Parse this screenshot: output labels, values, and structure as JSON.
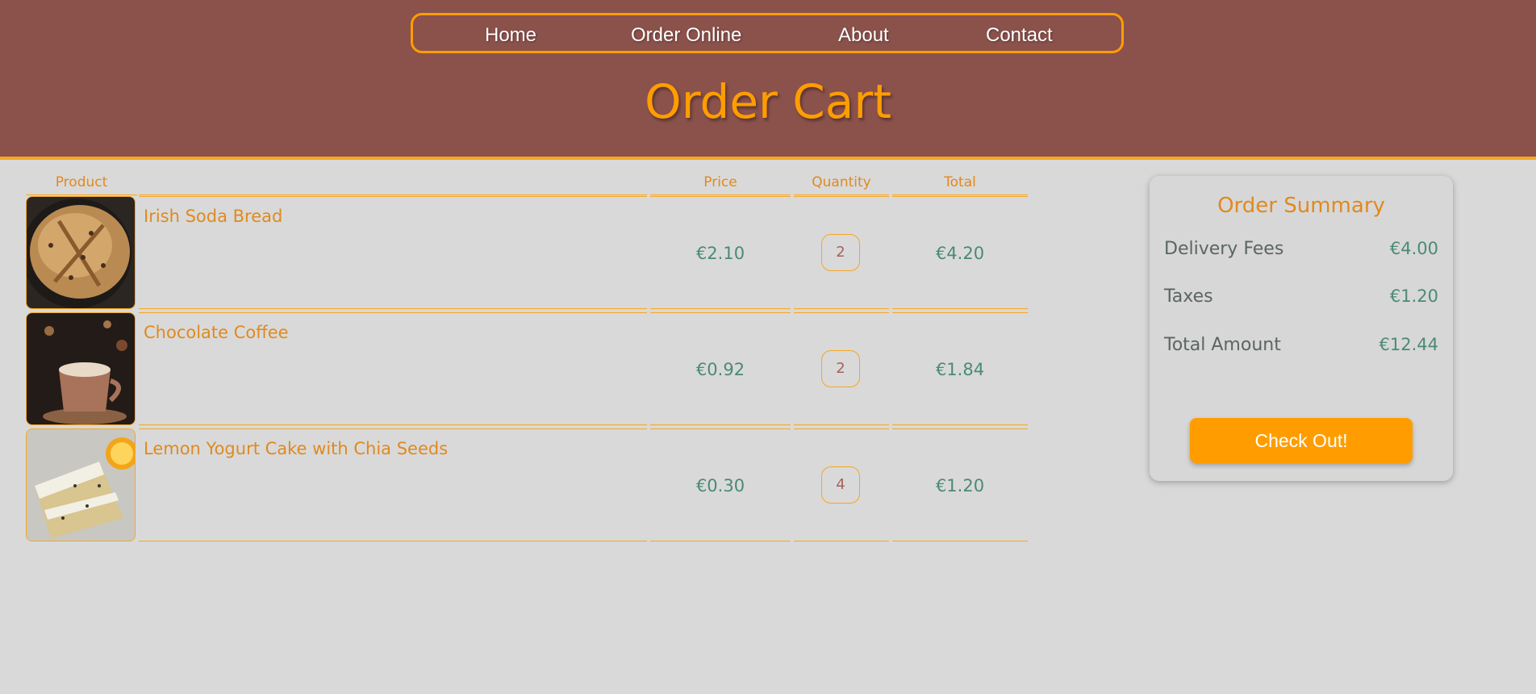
{
  "nav": {
    "items": [
      {
        "label": "Home"
      },
      {
        "label": "Order Online"
      },
      {
        "label": "About"
      },
      {
        "label": "Contact"
      }
    ]
  },
  "page_title": "Order Cart",
  "table": {
    "headers": {
      "product": "Product",
      "price": "Price",
      "quantity": "Quantity",
      "total": "Total"
    },
    "rows": [
      {
        "name": "Irish Soda Bread",
        "price": "€2.10",
        "quantity": "2",
        "total": "€4.20",
        "image": "soda-bread-photo"
      },
      {
        "name": "Chocolate Coffee",
        "price": "€0.92",
        "quantity": "2",
        "total": "€1.84",
        "image": "chocolate-coffee-photo"
      },
      {
        "name": "Lemon Yogurt Cake with Chia Seeds",
        "price": "€0.30",
        "quantity": "4",
        "total": "€1.20",
        "image": "lemon-cake-photo"
      }
    ]
  },
  "summary": {
    "title": "Order Summary",
    "lines": [
      {
        "label": "Delivery Fees",
        "value": "€4.00"
      },
      {
        "label": "Taxes",
        "value": "€1.20"
      },
      {
        "label": "Total Amount",
        "value": "€12.44"
      }
    ],
    "checkout_label": "Check Out!"
  },
  "colors": {
    "header_bg": "#8b514b",
    "accent": "#ff9d00",
    "page_bg": "#d9d9d9",
    "money": "#4a8a76"
  }
}
